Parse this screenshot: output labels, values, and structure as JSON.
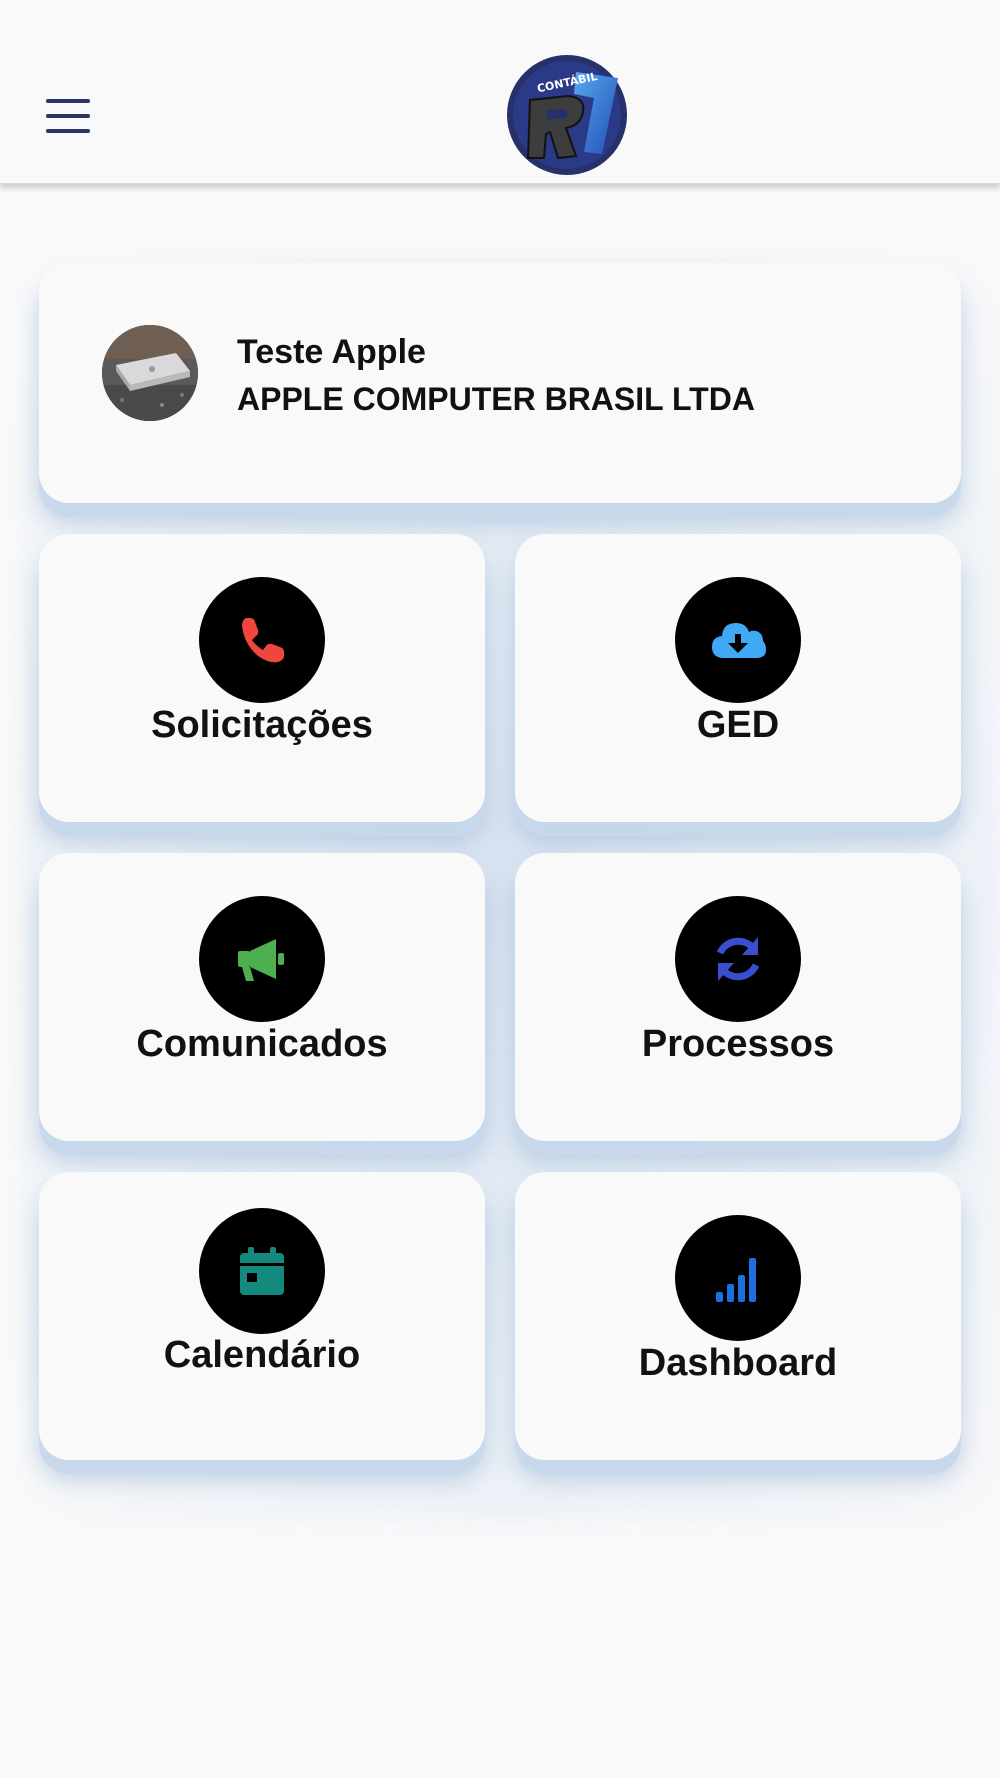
{
  "header": {
    "menu_icon": "hamburger-menu-icon",
    "logo_text": "CONTÁBIL",
    "logo_mark": "R7"
  },
  "profile": {
    "name": "Teste Apple",
    "company": "APPLE COMPUTER BRASIL LTDA"
  },
  "tiles": [
    {
      "label": "Solicitações",
      "icon": "phone-icon",
      "color": "#f0463c"
    },
    {
      "label": "GED",
      "icon": "cloud-download-icon",
      "color": "#3fa9f5"
    },
    {
      "label": "Comunicados",
      "icon": "megaphone-icon",
      "color": "#4caf50"
    },
    {
      "label": "Processos",
      "icon": "sync-icon",
      "color": "#3a4fd0"
    },
    {
      "label": "Calendário",
      "icon": "calendar-icon",
      "color": "#14897d"
    },
    {
      "label": "Dashboard",
      "icon": "signal-bars-icon",
      "color": "#1e6fe0"
    }
  ]
}
